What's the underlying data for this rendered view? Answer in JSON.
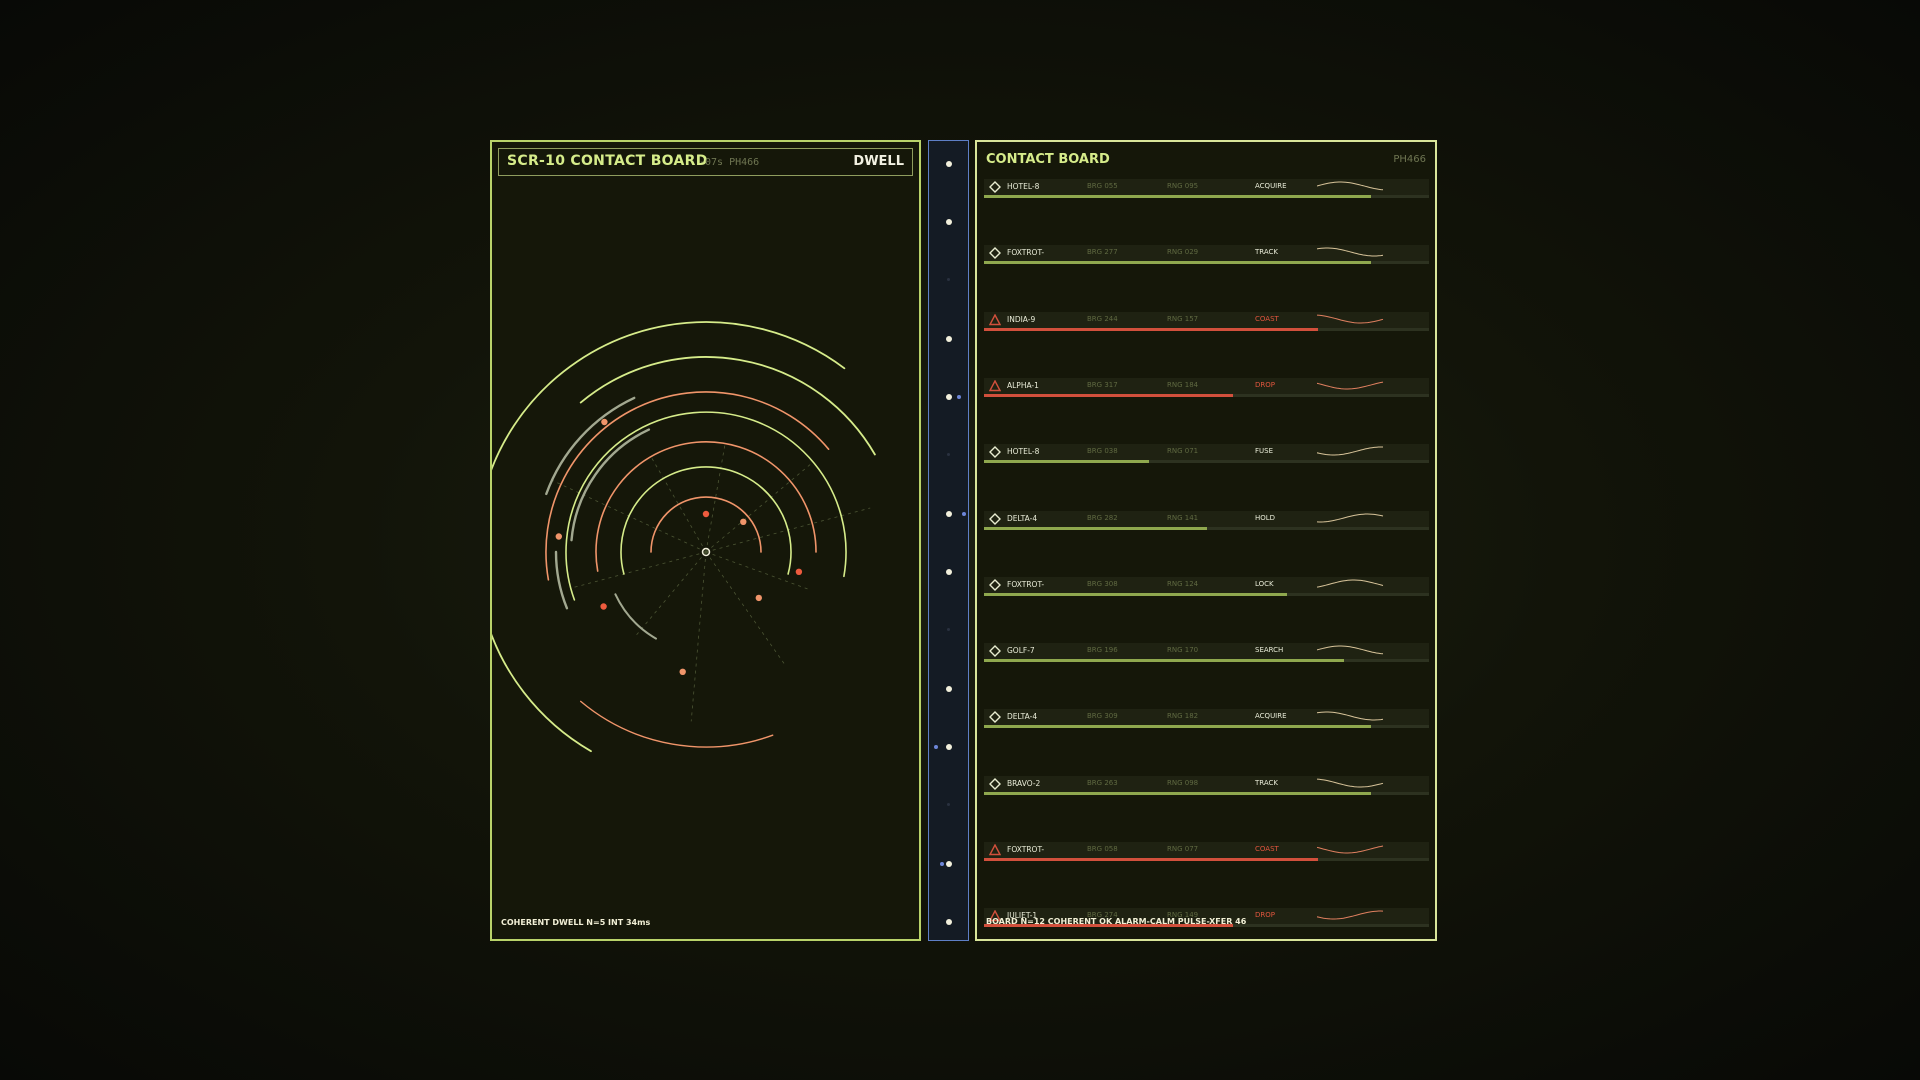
{
  "left": {
    "title": "SCR-10  CONTACT BOARD",
    "subtitle": "-07s  PH466",
    "mode": "DWELL",
    "footer": "COHERENT DWELL  N=5  INT 34ms"
  },
  "right": {
    "title": "CONTACT BOARD",
    "code": "PH466",
    "footer": "BOARD N=12  COHERENT OK  ALARM-CALM  PULSE-XFER 46"
  },
  "colors": {
    "ok": "#8fa84e",
    "alert": "#d2503c",
    "accent": "#d6ec8a",
    "orange": "#f0956a",
    "rail_blue": "#5e7fc6"
  },
  "contacts": [
    {
      "name": "HOTEL-8",
      "brg": "BRG 055",
      "rng": "RNG 095",
      "state": "ACQUIRE",
      "alert": false,
      "level": 0.87,
      "icon": "diamond-icon"
    },
    {
      "name": "FOXTROT-",
      "brg": "BRG 277",
      "rng": "RNG 029",
      "state": "TRACK",
      "alert": false,
      "level": 0.87,
      "icon": "diamond-icon"
    },
    {
      "name": "INDIA-9",
      "brg": "BRG 244",
      "rng": "RNG 157",
      "state": "COAST",
      "alert": true,
      "level": 0.75,
      "icon": "warning-triangle-icon"
    },
    {
      "name": "ALPHA-1",
      "brg": "BRG 317",
      "rng": "RNG 184",
      "state": "DROP",
      "alert": true,
      "level": 0.56,
      "icon": "warning-triangle-icon"
    },
    {
      "name": "HOTEL-8",
      "brg": "BRG 038",
      "rng": "RNG 071",
      "state": "FUSE",
      "alert": false,
      "level": 0.37,
      "icon": "diamond-icon"
    },
    {
      "name": "DELTA-4",
      "brg": "BRG 282",
      "rng": "RNG 141",
      "state": "HOLD",
      "alert": false,
      "level": 0.5,
      "icon": "diamond-icon"
    },
    {
      "name": "FOXTROT-",
      "brg": "BRG 308",
      "rng": "RNG 124",
      "state": "LOCK",
      "alert": false,
      "level": 0.68,
      "icon": "diamond-icon"
    },
    {
      "name": "GOLF-7",
      "brg": "BRG 196",
      "rng": "RNG 170",
      "state": "SEARCH",
      "alert": false,
      "level": 0.81,
      "icon": "diamond-icon"
    },
    {
      "name": "DELTA-4",
      "brg": "BRG 309",
      "rng": "RNG 182",
      "state": "ACQUIRE",
      "alert": false,
      "level": 0.87,
      "icon": "diamond-icon"
    },
    {
      "name": "BRAVO-2",
      "brg": "BRG 263",
      "rng": "RNG 098",
      "state": "TRACK",
      "alert": false,
      "level": 0.87,
      "icon": "diamond-icon"
    },
    {
      "name": "FOXTROT-",
      "brg": "BRG 058",
      "rng": "RNG 077",
      "state": "COAST",
      "alert": true,
      "level": 0.75,
      "icon": "warning-triangle-icon"
    },
    {
      "name": "JULIET-1",
      "brg": "BRG 274",
      "rng": "RNG 149",
      "state": "DROP",
      "alert": true,
      "level": 0.56,
      "icon": "warning-triangle-icon"
    }
  ]
}
